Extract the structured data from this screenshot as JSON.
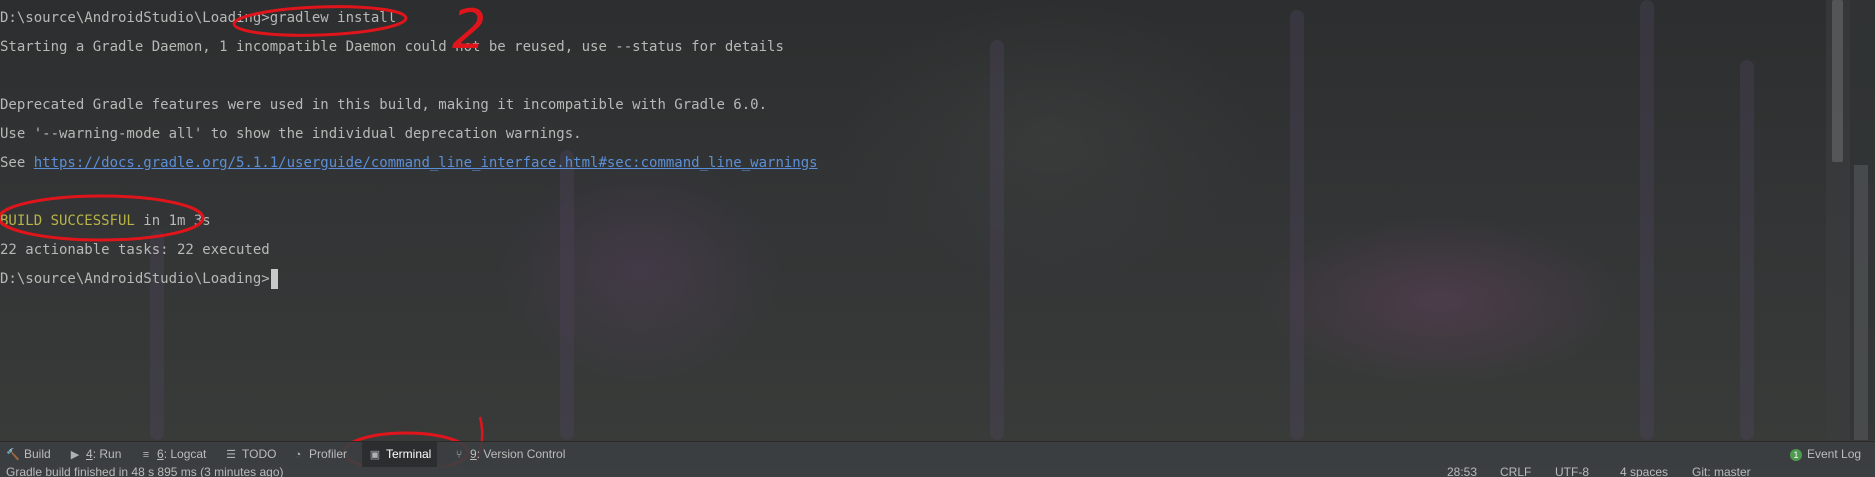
{
  "terminal": {
    "lines": [
      "D:\\source\\AndroidStudio\\Loading>gradlew install",
      "Starting a Gradle Daemon, 1 incompatible Daemon could not be reused, use --status for details",
      "",
      "Deprecated Gradle features were used in this build, making it incompatible with Gradle 6.0.",
      "Use '--warning-mode all' to show the individual deprecation warnings.",
      "See ",
      "",
      "",
      "22 actionable tasks: 22 executed",
      "D:\\source\\AndroidStudio\\Loading>"
    ],
    "link": "https://docs.gradle.org/5.1.1/userguide/command_line_interface.html#sec:command_line_warnings",
    "build_status": "BUILD SUCCESSFUL",
    "build_time": " in 1m 3s"
  },
  "toolbar": {
    "build": "Build",
    "run_num": "4",
    "run": ": Run",
    "logcat_num": "6",
    "logcat": ": Logcat",
    "todo": "TODO",
    "profiler": "Profiler",
    "terminal": "Terminal",
    "vcs_num": "9",
    "vcs": ": Version Control",
    "event_log": "Event Log",
    "event_count": "1"
  },
  "icons": {
    "build": "hammer-icon",
    "run": "play-icon",
    "logcat": "logcat-icon",
    "todo": "list-icon",
    "profiler": "gauge-icon",
    "terminal": "terminal-icon",
    "vcs": "branch-icon"
  },
  "statusbar": {
    "message": "Gradle build finished in 48 s 895 ms (3 minutes ago)",
    "position": "28:53",
    "line_sep": "CRLF",
    "encoding": "UTF-8",
    "indent": "4 spaces",
    "vcs": "Git: master"
  },
  "annotation": {
    "number": "2"
  },
  "colors": {
    "accent_annotation": "#e0151b",
    "link": "#5c8fd6",
    "success": "#b9b446"
  }
}
